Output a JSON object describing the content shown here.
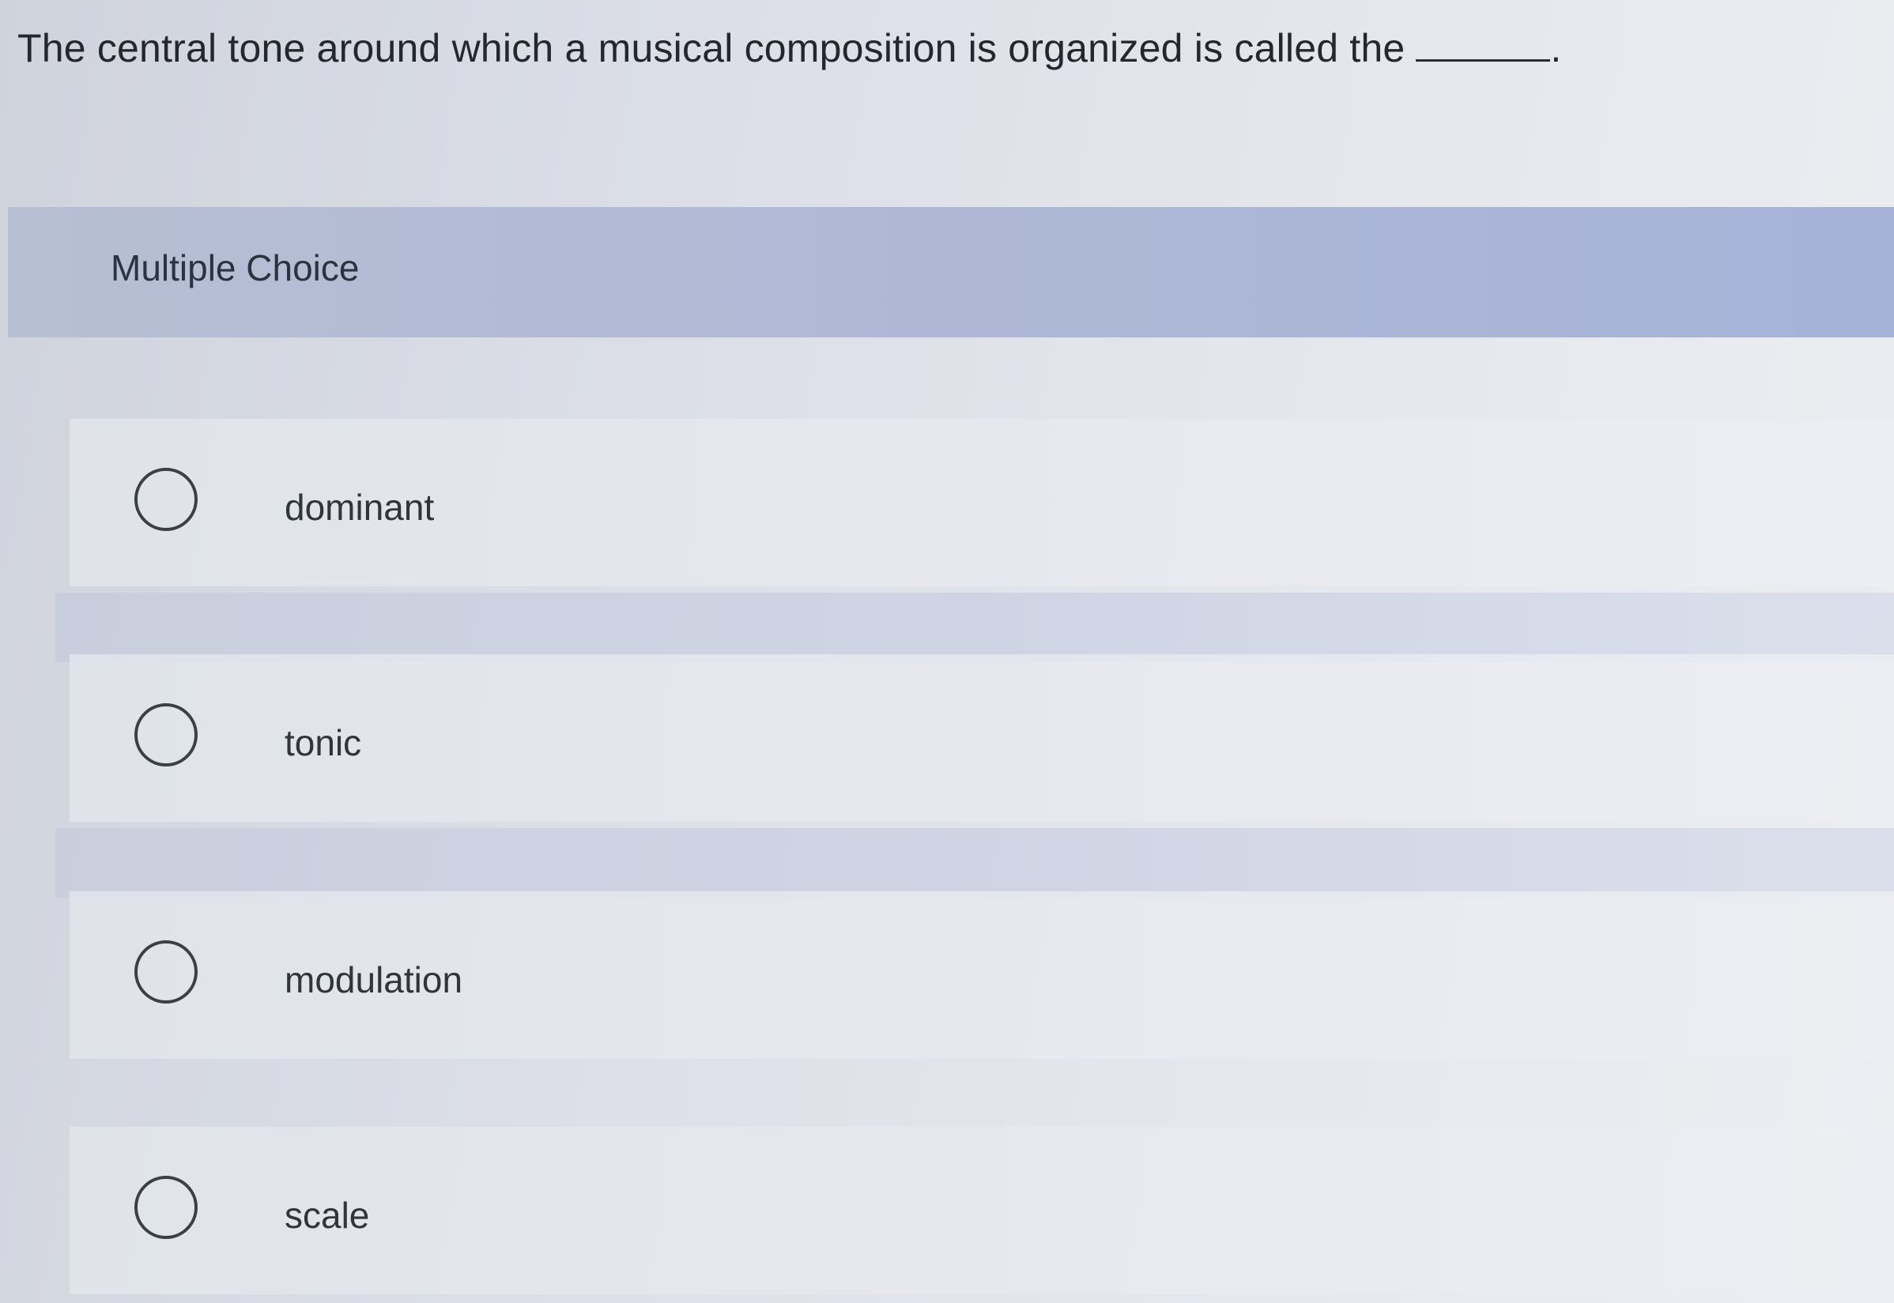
{
  "question": {
    "text": "The central tone around which a musical composition is organized is called the",
    "trailing": "."
  },
  "multiple_choice": {
    "title": "Multiple Choice",
    "options": [
      {
        "label": "dominant"
      },
      {
        "label": "tonic"
      },
      {
        "label": "modulation"
      },
      {
        "label": "scale"
      }
    ]
  }
}
